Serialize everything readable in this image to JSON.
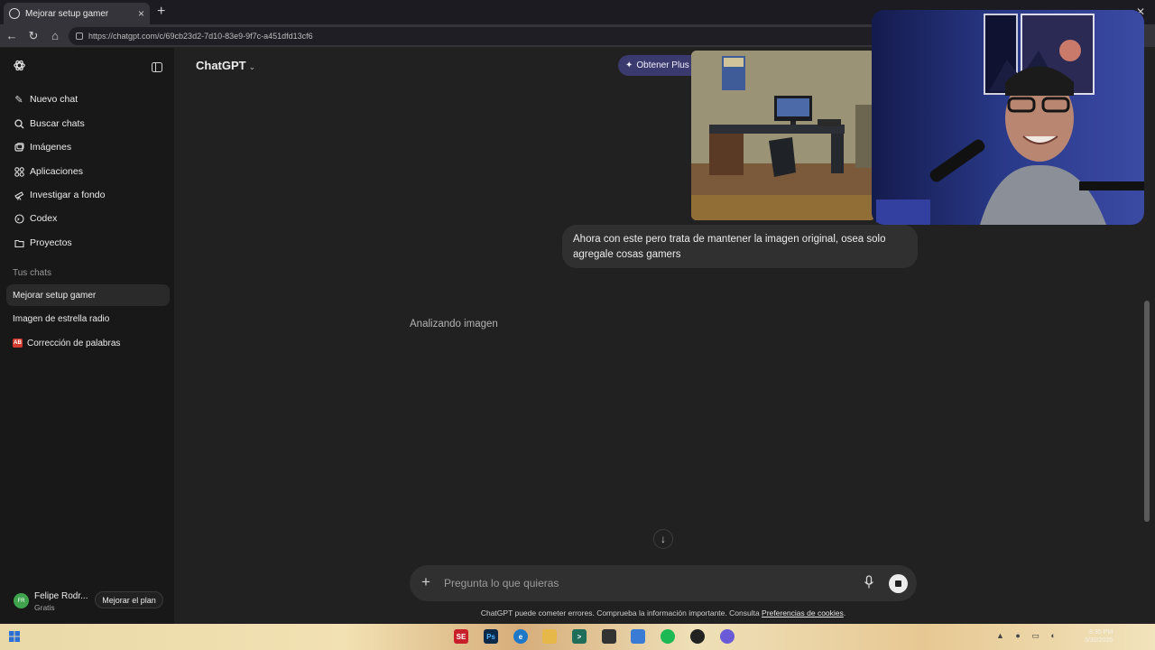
{
  "browser": {
    "tab_title": "Mejorar setup gamer",
    "tab_close": "×",
    "new_tab": "+",
    "url": "https://chatgpt.com/c/69cb23d2-7d10-83e9-9f7c-a451dfd13cf6"
  },
  "sidebar": {
    "items": [
      {
        "label": "Nuevo chat",
        "icon": "edit-icon"
      },
      {
        "label": "Buscar chats",
        "icon": "search-icon"
      },
      {
        "label": "Imágenes",
        "icon": "images-icon"
      },
      {
        "label": "Aplicaciones",
        "icon": "apps-icon"
      },
      {
        "label": "Investigar a fondo",
        "icon": "telescope-icon"
      },
      {
        "label": "Codex",
        "icon": "codex-icon"
      },
      {
        "label": "Proyectos",
        "icon": "folder-icon"
      }
    ],
    "section_label": "Tus chats",
    "chats": [
      {
        "label": "Mejorar setup gamer",
        "active": true
      },
      {
        "label": "Imagen de estrella radio",
        "active": false
      },
      {
        "label": "Corrección de palabras",
        "active": false,
        "badge": "AB"
      }
    ],
    "user": {
      "initials": "FR",
      "name": "Felipe Rodr...",
      "plan": "Gratis",
      "upgrade_label": "Mejorar el plan"
    }
  },
  "main": {
    "model_label": "ChatGPT",
    "plus_pill": {
      "label": "Obtener Plus",
      "close": "×"
    },
    "user_message": "Ahora con este pero trata de mantener la imagen original, osea solo agregale cosas gamers",
    "status": "Analizando imagen",
    "composer": {
      "placeholder": "Pregunta lo que quieras"
    },
    "disclaimer": {
      "text": "ChatGPT puede cometer errores. Comprueba la información importante. Consulta ",
      "link": "Preferencias de cookies",
      "end": "."
    }
  },
  "taskbar": {
    "clock_time": "8:35 PM",
    "clock_date": "3/30/2026"
  },
  "colors": {
    "background": "#212121",
    "sidebar": "#181818",
    "bubble": "#303030",
    "plus_pill": "#3b3a6e",
    "avatar": "#3fa34d"
  }
}
